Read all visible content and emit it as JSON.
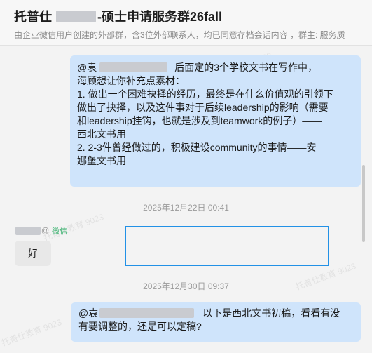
{
  "header": {
    "title_prefix": "托普仕",
    "title_suffix": "-硕士申请服务群26fall",
    "subtitle": "由企业微信用户创建的外部群，含3位外部联系人，均已同意存档会话内容 ，群主: 服务质"
  },
  "messages": [
    {
      "mention": "@袁",
      "text_first_line": "后面定的3个学校文书在写作中，",
      "lines": [
        "海顾想让你补充点素材：",
        "1. 做出一个困难抉择的经历，最终是在什么价值观的引领下",
        "做出了抉择，以及这件事对于后续leadership的影响（需要",
        "和leadership挂钩，也就是涉及到teamwork的例子）——",
        "西北文书用",
        "2. 2-3件曾经做过的，积极建设community的事情——安",
        "娜堡文书用"
      ]
    }
  ],
  "timestamps": [
    "2025年12月22日 00:41",
    "2025年12月30日 09:37"
  ],
  "sender": {
    "suffix": "@",
    "tag": "微信"
  },
  "reply": {
    "text": "好"
  },
  "message2": {
    "mention": "@袁",
    "text_first_line": "以下是西北文书初稿，看看有没",
    "line2": "有要调整的，还是可以定稿?"
  },
  "watermark": {
    "text": "托普仕教育 9023"
  }
}
